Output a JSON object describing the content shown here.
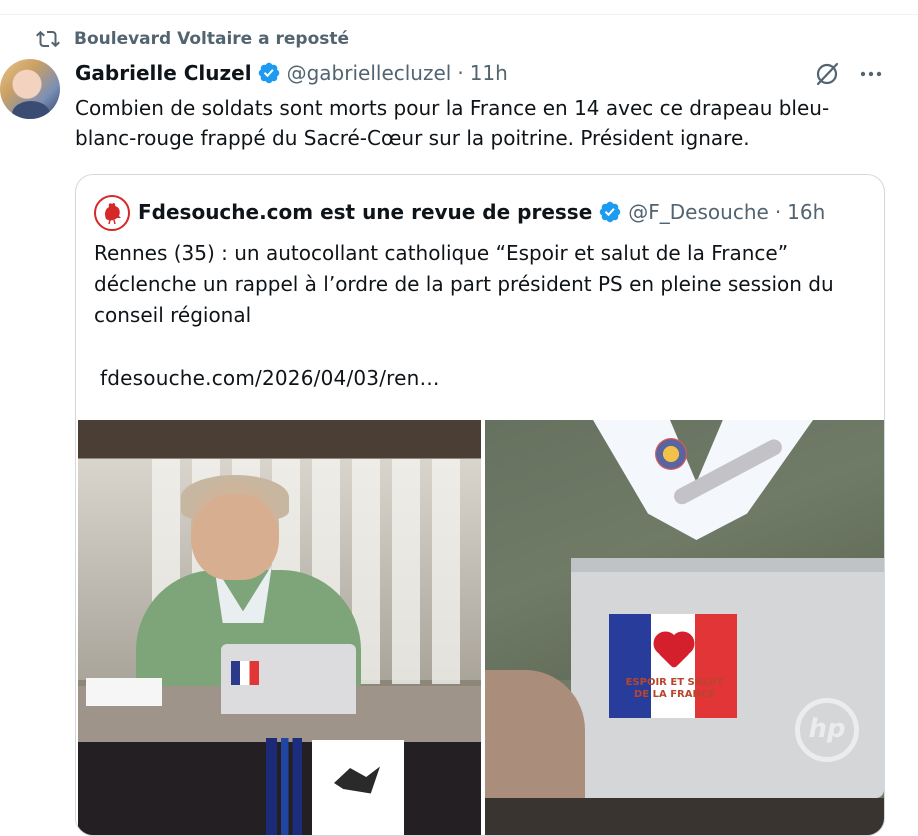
{
  "repost": {
    "icon": "repost-icon",
    "label": "Boulevard Voltaire a reposté"
  },
  "author": {
    "name": "Gabrielle Cluzel",
    "handle": "@gabriellecluzel",
    "separator": "·",
    "time": "11h",
    "verified_icon": "verified-badge-icon"
  },
  "tweet": {
    "text": "Combien de soldats sont morts pour la France en 14 avec ce drapeau bleu-blanc-rouge frappé du Sacré-Cœur sur la poitrine. Président ignare."
  },
  "actions": {
    "grok_icon": "grok-icon",
    "more_icon": "more-icon"
  },
  "quote": {
    "author_name": "Fdesouche.com est une revue de presse",
    "handle": "@F_Desouche",
    "separator": "·",
    "time": "16h",
    "text": "Rennes (35) : un autocollant catholique “Espoir et salut de la France” déclenche un rappel à l’ordre de la part président PS en pleine session du conseil régional",
    "link": "fdesouche.com/2026/04/03/ren…",
    "images": [
      {
        "kind": "photo",
        "subject": "council-session"
      },
      {
        "kind": "photo",
        "subject": "sticker-closeup",
        "flag_caption": "ESPOIR ET SALUT DE LA FRANCE",
        "logo_text": "hp"
      }
    ]
  },
  "colors": {
    "text": "#0f1419",
    "muted": "#536471",
    "verified": "#1d9bf0",
    "border": "#cfd9de"
  }
}
